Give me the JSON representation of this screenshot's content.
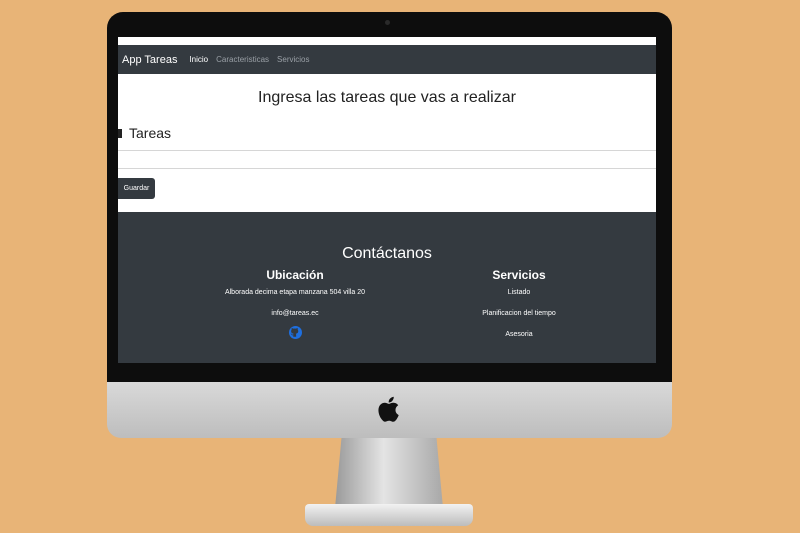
{
  "navbar": {
    "brand": "App Tareas",
    "links": [
      "Inicio",
      "Caracteristicas",
      "Servicios"
    ]
  },
  "main": {
    "heading": "Ingresa las tareas que vas a realizar",
    "section_title": "Tareas",
    "input_value": "",
    "save_label": "Guardar"
  },
  "footer": {
    "title": "Contáctanos",
    "location": {
      "title": "Ubicación",
      "address": "Alborada decima etapa manzana 504 villa 20",
      "email": "info@tareas.ec",
      "icon": "github-icon"
    },
    "services": {
      "title": "Servicios",
      "items": [
        "Listado",
        "Planificacion del tiempo",
        "Asesoria"
      ]
    }
  },
  "colors": {
    "background": "#e8b477",
    "navbar": "#343a40",
    "footer": "#343a40",
    "github": "#1e6fe0"
  },
  "icons": {
    "device_logo": "apple-logo-icon",
    "section_marker": "square-icon"
  }
}
